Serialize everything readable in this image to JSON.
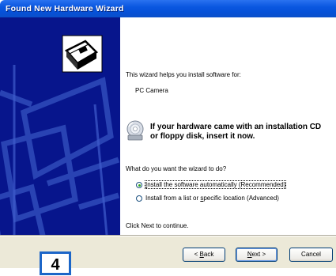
{
  "window": {
    "title": "Found New Hardware Wizard"
  },
  "wizard": {
    "intro": "This wizard helps you install software for:",
    "device": "PC Camera",
    "cd_notice_line1": "If your hardware came with an installation CD",
    "cd_notice_line2": "or floppy disk, insert it now.",
    "question": "What do you want the wizard to do?",
    "options": [
      {
        "pre": "",
        "key": "I",
        "rest": "nstall the software automatically (Recommended)",
        "selected": true
      },
      {
        "pre": "Install from a list or ",
        "key": "s",
        "rest": "pecific location (Advanced)",
        "selected": false
      }
    ],
    "continue_hint": "Click Next to continue."
  },
  "buttons": {
    "back_pre": "< ",
    "back_key": "B",
    "back_rest": "ack",
    "next_key": "N",
    "next_rest": "ext >",
    "cancel": "Cancel"
  },
  "step_badge": "4",
  "colors": {
    "banner": "#07158c",
    "titlebar": "#0a57e0"
  },
  "icons": {
    "banner": "hardware-card-icon",
    "notice": "cd-icon"
  }
}
